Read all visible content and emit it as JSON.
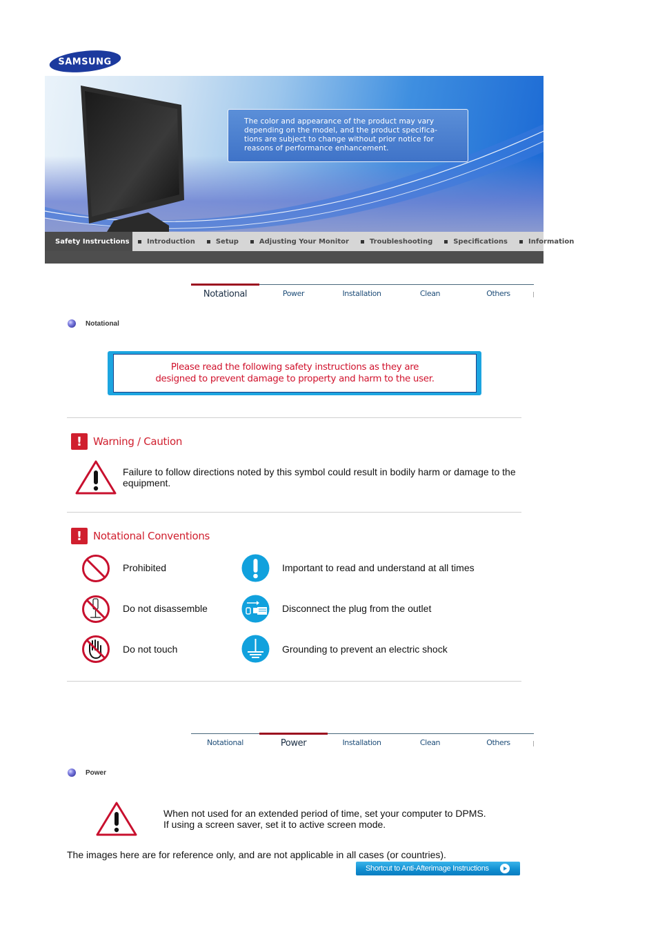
{
  "brand": {
    "logo_text": "SAMSUNG"
  },
  "banner": {
    "notice_lines": [
      "The color and appearance of the product may vary",
      "depending on the model, and the product specifica-",
      "tions are subject to change without prior notice for",
      "reasons of performance enhancement."
    ]
  },
  "main_nav": {
    "items": [
      {
        "label": "Safety Instructions",
        "active": true
      },
      {
        "label": "Introduction",
        "active": false
      },
      {
        "label": "Setup",
        "active": false
      },
      {
        "label": "Adjusting Your Monitor",
        "active": false
      },
      {
        "label": "Troubleshooting",
        "active": false
      },
      {
        "label": "Specifications",
        "active": false
      },
      {
        "label": "Information",
        "active": false
      }
    ]
  },
  "sub_tabs": [
    "Notational",
    "Power",
    "Installation",
    "Clean",
    "Others"
  ],
  "section_notational": {
    "heading": "Notational",
    "safety_notice_lines": [
      "Please read the following safety instructions as they are",
      "designed to prevent damage to property and harm to the user."
    ],
    "warning": {
      "title": "Warning / Caution",
      "text": "Failure to follow directions noted by this symbol could result in bodily harm or damage to the equipment."
    },
    "conventions": {
      "title": "Notational Conventions",
      "items": [
        {
          "icon": "prohibited-icon",
          "label": "Prohibited"
        },
        {
          "icon": "important-icon",
          "label": "Important to read and understand at all times"
        },
        {
          "icon": "no-disassemble-icon",
          "label": "Do not disassemble"
        },
        {
          "icon": "unplug-icon",
          "label": "Disconnect the plug from the outlet"
        },
        {
          "icon": "no-touch-icon",
          "label": "Do not touch"
        },
        {
          "icon": "grounding-icon",
          "label": "Grounding to prevent an electric shock"
        }
      ]
    }
  },
  "section_power": {
    "heading": "Power",
    "warning_lines": [
      "When not used for an extended period of time, set your computer to DPMS.",
      "If using a screen saver, set it to active screen mode."
    ]
  },
  "footer": {
    "disclaimer": "The images here are for reference only, and are not applicable in all cases (or countries).",
    "shortcut_label": "Shortcut to Anti-Afterimage Instructions"
  },
  "colors": {
    "accent_red": "#d01f2e",
    "accent_blue": "#1ca5e0",
    "active_tab_bar": "#9b0a1e",
    "nav_dark": "#4b4b4b"
  }
}
